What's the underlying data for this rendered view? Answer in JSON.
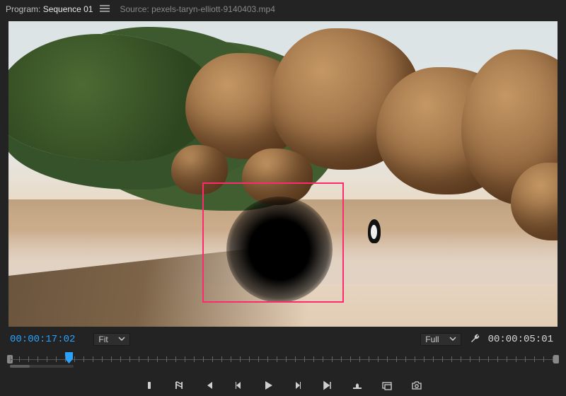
{
  "header": {
    "program_prefix": "Program:",
    "sequence_name": "Sequence 01",
    "source_prefix": "Source:",
    "source_name": "pexels-taryn-elliott-9140403.mp4"
  },
  "monitor": {
    "fit_label": "Fit",
    "quality_label": "Full",
    "timecode_current": "00:00:17:02",
    "timecode_duration": "00:00:05:01"
  },
  "transport": {
    "mark_in": "Mark In",
    "mark_out": "Mark Out",
    "go_to_in": "Go to In",
    "step_back": "Step Back",
    "play": "Play",
    "step_forward": "Step Forward",
    "go_to_out": "Go to Out",
    "lift": "Lift",
    "extract": "Extract",
    "export_frame": "Export Frame"
  },
  "icons": {
    "menu": "panel-menu-icon",
    "chevron_down": "chevron-down-icon",
    "wrench": "settings-wrench-icon"
  }
}
